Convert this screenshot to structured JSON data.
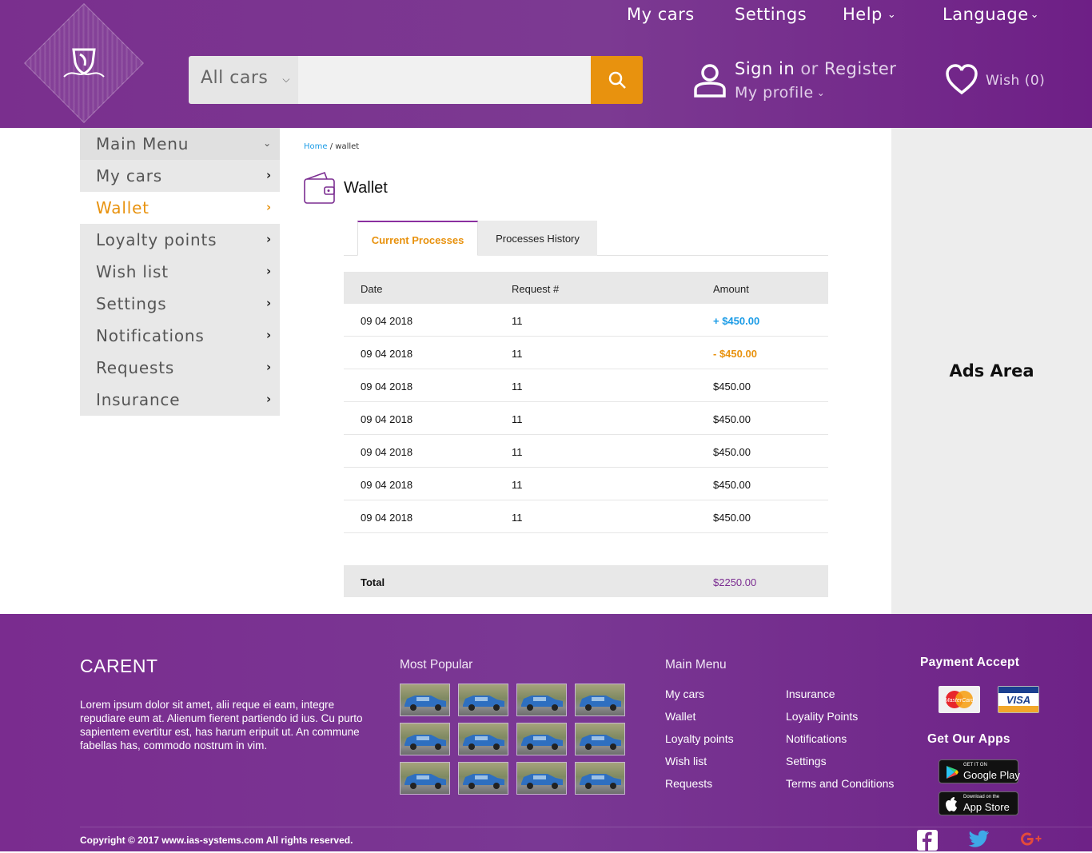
{
  "header": {
    "nav": {
      "my_cars": "My cars",
      "settings": "Settings",
      "help": "Help",
      "language": "Language"
    },
    "search": {
      "category": "All cars",
      "placeholder": "",
      "value": ""
    },
    "account": {
      "sign_in": "Sign in",
      "or": "or",
      "register": "Register",
      "my_profile": "My profile"
    },
    "wish": "Wish (0)"
  },
  "sidebar": {
    "title": "Main Menu",
    "items": [
      {
        "label": "My cars"
      },
      {
        "label": "Wallet",
        "active": true
      },
      {
        "label": "Loyalty points"
      },
      {
        "label": "Wish list"
      },
      {
        "label": "Settings"
      },
      {
        "label": "Notifications"
      },
      {
        "label": "Requests"
      },
      {
        "label": "Insurance"
      }
    ]
  },
  "breadcrumb": {
    "home": "Home",
    "separator": "/",
    "current": "wallet"
  },
  "main": {
    "title": "Wallet",
    "tabs": [
      {
        "label": "Current Processes",
        "active": true
      },
      {
        "label": "Processes History"
      }
    ],
    "table": {
      "columns": [
        "Date",
        "Request #",
        "Amount"
      ],
      "rows": [
        {
          "date": "09 04 2018",
          "request": "11",
          "amount": "+ $450.00",
          "type": "positive"
        },
        {
          "date": "09 04 2018",
          "request": "11",
          "amount": "- $450.00",
          "type": "negative"
        },
        {
          "date": "09 04 2018",
          "request": "11",
          "amount": "$450.00",
          "type": "neutral"
        },
        {
          "date": "09 04 2018",
          "request": "11",
          "amount": "$450.00",
          "type": "neutral"
        },
        {
          "date": "09 04 2018",
          "request": "11",
          "amount": "$450.00",
          "type": "neutral"
        },
        {
          "date": "09 04 2018",
          "request": "11",
          "amount": "$450.00",
          "type": "neutral"
        },
        {
          "date": "09 04 2018",
          "request": "11",
          "amount": "$450.00",
          "type": "neutral"
        }
      ],
      "total_label": "Total",
      "total_value": "$2250.00"
    }
  },
  "ads": {
    "label": "Ads Area"
  },
  "footer": {
    "brand": "CARENT",
    "about": "Lorem ipsum dolor sit amet, alii reque ei eam, integre repudiare eum at. Alienum fierent partiendo id ius. Cu purto sapientem evertitur est, has harum eripuit ut. An commune fabellas has, commodo nostrum in vim.",
    "most_popular": "Most Popular",
    "main_menu": "Main Menu",
    "menu_col1": [
      "My cars",
      "Wallet",
      "Loyalty points",
      "Wish list",
      "Requests"
    ],
    "menu_col2": [
      "Insurance",
      "Loyality Points",
      "Notifications",
      "Settings",
      "Terms and Conditions"
    ],
    "payment_accept": "Payment Accept",
    "get_apps": "Get Our Apps",
    "cards": {
      "mastercard": "MasterCard",
      "visa": "VISA"
    },
    "google_play": {
      "small": "GET IT ON",
      "big": "Google Play"
    },
    "app_store": {
      "small": "Download on the",
      "big": "App Store"
    },
    "copyright": "Copyright © 2017 www.ias-systems.com  All rights reserved."
  },
  "colors": {
    "brand_purple": "#7a2f8e",
    "accent_orange": "#e8920e",
    "positive_blue": "#1a9be6",
    "total_purple": "#7b2d91"
  },
  "icons": [
    "logo-icon",
    "chevron-down-icon",
    "search-icon",
    "user-icon",
    "heart-icon",
    "chevron-right-icon",
    "wallet-icon",
    "facebook-icon",
    "twitter-icon",
    "google-plus-icon",
    "google-play-icon",
    "apple-icon"
  ]
}
